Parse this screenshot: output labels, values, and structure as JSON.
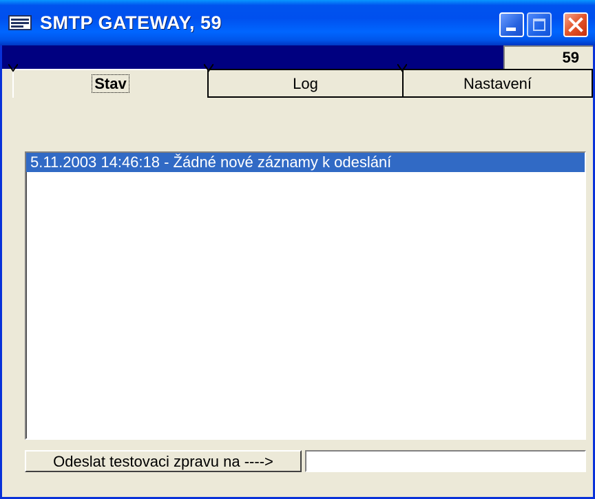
{
  "window": {
    "title": "SMTP GATEWAY, 59",
    "counter": "59"
  },
  "tabs": [
    {
      "label": "Stav",
      "active": true
    },
    {
      "label": "Log",
      "active": false
    },
    {
      "label": "Nastavení",
      "active": false
    }
  ],
  "log": {
    "entries": [
      {
        "text": "5.11.2003 14:46:18 - Žádné nové záznamy k odeslání",
        "selected": true
      }
    ]
  },
  "send": {
    "button_label": "Odeslat testovaci zpravu na ---->",
    "email_value": ""
  },
  "icons": {
    "app": "mail-envelope-icon",
    "minimize": "minimize-icon",
    "maximize": "maximize-icon",
    "close": "close-icon"
  },
  "colors": {
    "titlebar": "#0055ea",
    "statusbar": "#000080",
    "selection": "#316ac5",
    "window_bg": "#ece9d8",
    "close_button": "#e3542a"
  }
}
